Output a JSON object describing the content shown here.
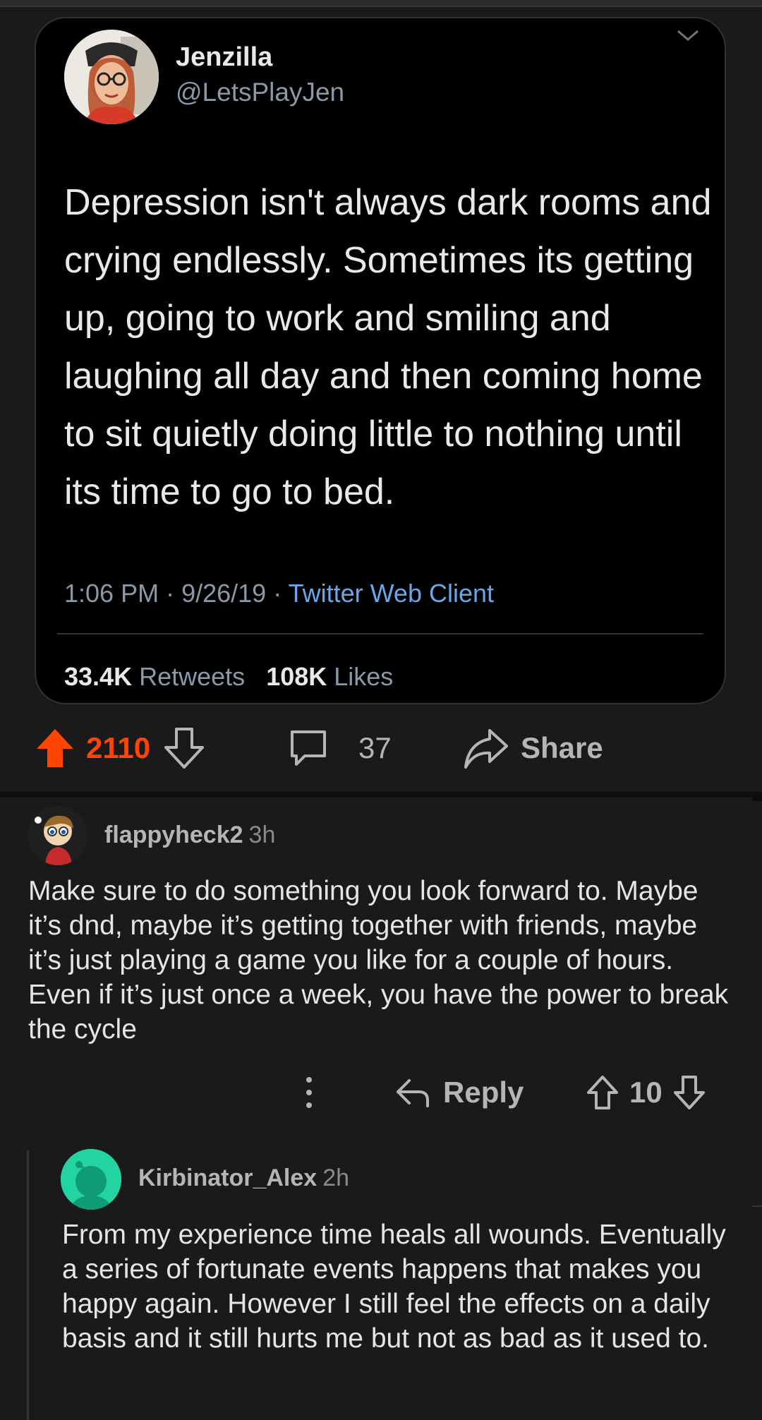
{
  "tweet": {
    "display_name": "Jenzilla",
    "handle": "@LetsPlayJen",
    "text": "Depression isn't always dark rooms and crying endlessly. Sometimes its getting up, going to work and smiling and laughing all day and then coming home to sit quietly doing little to nothing until its time to go to bed.",
    "time": "1:06 PM",
    "date": "9/26/19",
    "client": "Twitter Web Client",
    "retweets_count": "33.4K",
    "retweets_label": "Retweets",
    "likes_count": "108K",
    "likes_label": "Likes"
  },
  "post_actions": {
    "upvotes": "2110",
    "comments": "37",
    "share_label": "Share"
  },
  "comments": [
    {
      "author": "flappyheck2",
      "age": "3h",
      "body": "Make sure to do something you look forward to. Maybe it’s dnd, maybe it’s getting together with friends, maybe it’s just playing a game you like for a couple of hours. Even if it’s just once a week, you have the power to break the cycle",
      "reply_label": "Reply",
      "votes": "10"
    },
    {
      "author": "Kirbinator_Alex",
      "age": "2h",
      "body": "From my experience time heals all wounds. Eventually a series of fortunate events happens that makes you happy again. However I still feel the effects on a daily basis and it still hurts me but not as bad as it used to."
    }
  ],
  "colors": {
    "background": "#1a1a1b",
    "tweet_background": "#000000",
    "upvote_active": "#ff4500",
    "link_blue": "#6aa7e8",
    "reply_avatar": "#24d4a0"
  },
  "icons": [
    "chevron-down-icon",
    "upvote-icon",
    "downvote-icon",
    "comment-icon",
    "share-icon",
    "more-icon",
    "reply-icon"
  ]
}
